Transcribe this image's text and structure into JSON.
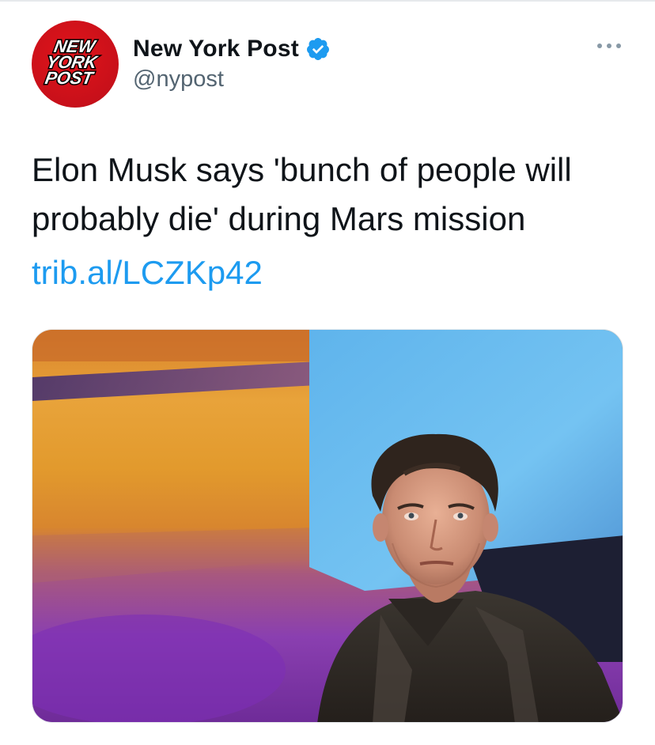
{
  "account": {
    "display_name": "New York Post",
    "handle": "@nypost",
    "verified": true,
    "avatar_logo": "NEW YORK POST"
  },
  "tweet": {
    "text": "Elon Musk says 'bunch of people will probably die' during Mars mission",
    "link": "trib.al/LCZKp42"
  },
  "icons": {
    "verified": "verified-badge-icon",
    "more": "more-options-icon"
  },
  "colors": {
    "link": "#1d9bf0",
    "verified": "#1d9bf0",
    "avatar_red": "#c8101a",
    "handle": "#536471"
  }
}
